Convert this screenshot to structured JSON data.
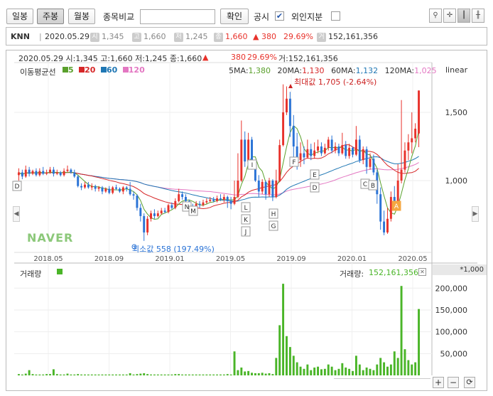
{
  "toolbar": {
    "daily": "일봉",
    "weekly": "주봉",
    "monthly": "월봉",
    "compare_label": "종목비교",
    "compare_placeholder": "",
    "confirm": "확인",
    "disclosure": "공시",
    "disclosure_checked": "✔",
    "foreign": "외인지분",
    "icons": [
      "pin-icon",
      "crosshair-icon",
      "candle-toggle-icon",
      "bar-settings-icon"
    ]
  },
  "ticker": {
    "name": "KNN",
    "date": "2020.05.29",
    "open_badge": "시",
    "open": "1,345",
    "high_badge": "고",
    "high": "1,660",
    "low_badge": "저",
    "low": "1,245",
    "close_badge": "종",
    "close": "1,660",
    "change": "▲ 380",
    "change_pct": "29.69%",
    "volume_badge": "거",
    "volume": "152,161,356"
  },
  "chart_header": {
    "line": "2020.05.29 시:1,345 고:1,660 저:1,245 종:1,660",
    "arrow": "▲",
    "change": "380",
    "pct": "29.69%",
    "vol": "거:152,161,356"
  },
  "ma_legend": {
    "label": "이동평균선",
    "items": [
      {
        "text": "5",
        "color": "#5aa02c"
      },
      {
        "text": "20",
        "color": "#d62728"
      },
      {
        "text": "60",
        "color": "#1f77b4"
      },
      {
        "text": "120",
        "color": "#e377c2"
      }
    ],
    "values": [
      {
        "label": "5MA:",
        "value": "1,380",
        "color": "#5aa02c"
      },
      {
        "label": "20MA:",
        "value": "1,130",
        "color": "#d62728"
      },
      {
        "label": "60MA:",
        "value": "1,132",
        "color": "#1f77b4"
      },
      {
        "label": "120MA:",
        "value": "1,025",
        "color": "#e377c2"
      }
    ],
    "scale": "linear"
  },
  "annotations": {
    "max": "최대값 1,705 (-2.64%)",
    "min": "최소값 558 (197.49%)",
    "watermark": "NAVER",
    "event_labels": [
      "D",
      "I",
      "F",
      "E",
      "D",
      "C",
      "B",
      "A",
      "N",
      "M",
      "L",
      "K",
      "J",
      "H",
      "G"
    ]
  },
  "volume_panel": {
    "label": "거래량",
    "value_label": "거래량:",
    "value": "152,161,356",
    "unit": "*1,000",
    "ticks": [
      "200,000",
      "150,000",
      "100,000",
      "50,000"
    ]
  },
  "colors": {
    "up": "#e8322b",
    "down": "#2a73d6",
    "vol": "#4ab528",
    "ma5": "#5aa02c",
    "ma20": "#d62728",
    "ma60": "#1f77b4",
    "ma120": "#e377c2"
  },
  "chart_data": {
    "type": "candlestick",
    "x_ticks": [
      "2018.05",
      "2018.09",
      "2019.01",
      "2019.05",
      "2019.09",
      "2020.01",
      "2020.05"
    ],
    "y_ticks": [
      "1,500",
      "1,000"
    ],
    "ylim": [
      500,
      1750
    ],
    "volume_ticks": [
      200000,
      150000,
      100000,
      50000
    ],
    "weeks": [
      {
        "o": 1040,
        "c": 1060,
        "h": 1090,
        "l": 1000,
        "v": 3000
      },
      {
        "o": 1060,
        "c": 1030,
        "h": 1080,
        "l": 1010,
        "v": 2000
      },
      {
        "o": 1030,
        "c": 1080,
        "h": 1110,
        "l": 1020,
        "v": 4000
      },
      {
        "o": 1080,
        "c": 1050,
        "h": 1100,
        "l": 1030,
        "v": 12000
      },
      {
        "o": 1050,
        "c": 1070,
        "h": 1080,
        "l": 1040,
        "v": 3000
      },
      {
        "o": 1070,
        "c": 1040,
        "h": 1090,
        "l": 1030,
        "v": 2000
      },
      {
        "o": 1040,
        "c": 1070,
        "h": 1090,
        "l": 1030,
        "v": 2000
      },
      {
        "o": 1070,
        "c": 1050,
        "h": 1100,
        "l": 1040,
        "v": 2000
      },
      {
        "o": 1050,
        "c": 1060,
        "h": 1080,
        "l": 1040,
        "v": 3000
      },
      {
        "o": 1060,
        "c": 1080,
        "h": 1100,
        "l": 1050,
        "v": 3000
      },
      {
        "o": 1080,
        "c": 1050,
        "h": 1100,
        "l": 1030,
        "v": 14000
      },
      {
        "o": 1050,
        "c": 1060,
        "h": 1080,
        "l": 1040,
        "v": 3000
      },
      {
        "o": 1060,
        "c": 1040,
        "h": 1070,
        "l": 1030,
        "v": 2000
      },
      {
        "o": 1040,
        "c": 1070,
        "h": 1090,
        "l": 1030,
        "v": 2000
      },
      {
        "o": 1070,
        "c": 1080,
        "h": 1110,
        "l": 1060,
        "v": 4000
      },
      {
        "o": 1080,
        "c": 1060,
        "h": 1090,
        "l": 1050,
        "v": 2000
      },
      {
        "o": 1060,
        "c": 1030,
        "h": 1080,
        "l": 1020,
        "v": 2000
      },
      {
        "o": 1030,
        "c": 960,
        "h": 1040,
        "l": 950,
        "v": 3000
      },
      {
        "o": 960,
        "c": 950,
        "h": 980,
        "l": 930,
        "v": 2000
      },
      {
        "o": 950,
        "c": 970,
        "h": 990,
        "l": 940,
        "v": 2000
      },
      {
        "o": 970,
        "c": 950,
        "h": 990,
        "l": 940,
        "v": 2000
      },
      {
        "o": 950,
        "c": 960,
        "h": 980,
        "l": 930,
        "v": 2000
      },
      {
        "o": 960,
        "c": 940,
        "h": 970,
        "l": 920,
        "v": 2000
      },
      {
        "o": 940,
        "c": 950,
        "h": 960,
        "l": 920,
        "v": 2000
      },
      {
        "o": 950,
        "c": 920,
        "h": 960,
        "l": 900,
        "v": 2000
      },
      {
        "o": 920,
        "c": 940,
        "h": 950,
        "l": 910,
        "v": 2000
      },
      {
        "o": 940,
        "c": 910,
        "h": 960,
        "l": 900,
        "v": 2000
      },
      {
        "o": 910,
        "c": 950,
        "h": 960,
        "l": 900,
        "v": 2000
      },
      {
        "o": 950,
        "c": 940,
        "h": 970,
        "l": 930,
        "v": 2000
      },
      {
        "o": 940,
        "c": 920,
        "h": 950,
        "l": 910,
        "v": 2000
      },
      {
        "o": 920,
        "c": 950,
        "h": 960,
        "l": 900,
        "v": 2000
      },
      {
        "o": 950,
        "c": 940,
        "h": 960,
        "l": 920,
        "v": 2000
      },
      {
        "o": 940,
        "c": 900,
        "h": 990,
        "l": 890,
        "v": 5000
      },
      {
        "o": 900,
        "c": 890,
        "h": 920,
        "l": 860,
        "v": 2000
      },
      {
        "o": 890,
        "c": 800,
        "h": 900,
        "l": 780,
        "v": 3000
      },
      {
        "o": 800,
        "c": 740,
        "h": 830,
        "l": 700,
        "v": 4000
      },
      {
        "o": 740,
        "c": 620,
        "h": 760,
        "l": 558,
        "v": 5000
      },
      {
        "o": 620,
        "c": 720,
        "h": 740,
        "l": 600,
        "v": 3000
      },
      {
        "o": 720,
        "c": 760,
        "h": 780,
        "l": 700,
        "v": 2000
      },
      {
        "o": 760,
        "c": 740,
        "h": 790,
        "l": 720,
        "v": 2000
      },
      {
        "o": 740,
        "c": 760,
        "h": 780,
        "l": 730,
        "v": 2000
      },
      {
        "o": 760,
        "c": 780,
        "h": 800,
        "l": 750,
        "v": 2000
      },
      {
        "o": 780,
        "c": 770,
        "h": 800,
        "l": 760,
        "v": 2000
      },
      {
        "o": 770,
        "c": 820,
        "h": 830,
        "l": 760,
        "v": 2000
      },
      {
        "o": 820,
        "c": 800,
        "h": 840,
        "l": 790,
        "v": 2000
      },
      {
        "o": 800,
        "c": 850,
        "h": 870,
        "l": 790,
        "v": 3000
      },
      {
        "o": 850,
        "c": 900,
        "h": 940,
        "l": 840,
        "v": 3000
      },
      {
        "o": 900,
        "c": 880,
        "h": 920,
        "l": 860,
        "v": 2000
      },
      {
        "o": 880,
        "c": 850,
        "h": 900,
        "l": 830,
        "v": 2000
      },
      {
        "o": 850,
        "c": 810,
        "h": 860,
        "l": 800,
        "v": 2000
      },
      {
        "o": 810,
        "c": 800,
        "h": 830,
        "l": 780,
        "v": 2000
      },
      {
        "o": 800,
        "c": 830,
        "h": 850,
        "l": 790,
        "v": 2000
      },
      {
        "o": 830,
        "c": 820,
        "h": 850,
        "l": 800,
        "v": 2000
      },
      {
        "o": 820,
        "c": 840,
        "h": 860,
        "l": 810,
        "v": 2000
      },
      {
        "o": 840,
        "c": 850,
        "h": 870,
        "l": 830,
        "v": 2000
      },
      {
        "o": 850,
        "c": 860,
        "h": 880,
        "l": 840,
        "v": 2000
      },
      {
        "o": 860,
        "c": 850,
        "h": 880,
        "l": 840,
        "v": 2000
      },
      {
        "o": 850,
        "c": 870,
        "h": 890,
        "l": 840,
        "v": 2000
      },
      {
        "o": 870,
        "c": 860,
        "h": 900,
        "l": 850,
        "v": 2000
      },
      {
        "o": 860,
        "c": 880,
        "h": 900,
        "l": 840,
        "v": 2000
      },
      {
        "o": 880,
        "c": 850,
        "h": 890,
        "l": 800,
        "v": 3000
      },
      {
        "o": 850,
        "c": 830,
        "h": 880,
        "l": 790,
        "v": 2000
      },
      {
        "o": 830,
        "c": 880,
        "h": 1000,
        "l": 820,
        "v": 55000
      },
      {
        "o": 880,
        "c": 1000,
        "h": 1200,
        "l": 870,
        "v": 12000
      },
      {
        "o": 1000,
        "c": 1300,
        "h": 1440,
        "l": 990,
        "v": 18000
      },
      {
        "o": 1300,
        "c": 1140,
        "h": 1360,
        "l": 1100,
        "v": 9000
      },
      {
        "o": 1140,
        "c": 1300,
        "h": 1350,
        "l": 1120,
        "v": 10000
      },
      {
        "o": 1300,
        "c": 1130,
        "h": 1320,
        "l": 1080,
        "v": 6000
      },
      {
        "o": 1130,
        "c": 1000,
        "h": 1150,
        "l": 990,
        "v": 5000
      },
      {
        "o": 1000,
        "c": 920,
        "h": 1040,
        "l": 880,
        "v": 5000
      },
      {
        "o": 920,
        "c": 990,
        "h": 1010,
        "l": 900,
        "v": 6000
      },
      {
        "o": 990,
        "c": 900,
        "h": 1000,
        "l": 860,
        "v": 4000
      },
      {
        "o": 900,
        "c": 1000,
        "h": 1020,
        "l": 880,
        "v": 5000
      },
      {
        "o": 1000,
        "c": 880,
        "h": 1010,
        "l": 850,
        "v": 3000
      },
      {
        "o": 880,
        "c": 1000,
        "h": 1080,
        "l": 870,
        "v": 40000
      },
      {
        "o": 1000,
        "c": 1260,
        "h": 1300,
        "l": 990,
        "v": 115000
      },
      {
        "o": 1260,
        "c": 1500,
        "h": 1705,
        "l": 1250,
        "v": 210000
      },
      {
        "o": 1500,
        "c": 1600,
        "h": 1690,
        "l": 1480,
        "v": 90000
      },
      {
        "o": 1600,
        "c": 1400,
        "h": 1650,
        "l": 1320,
        "v": 65000
      },
      {
        "o": 1400,
        "c": 1250,
        "h": 1480,
        "l": 1150,
        "v": 45000
      },
      {
        "o": 1250,
        "c": 1150,
        "h": 1350,
        "l": 1080,
        "v": 30000
      },
      {
        "o": 1150,
        "c": 1200,
        "h": 1280,
        "l": 1100,
        "v": 20000
      },
      {
        "o": 1200,
        "c": 1170,
        "h": 1250,
        "l": 1120,
        "v": 15000
      },
      {
        "o": 1170,
        "c": 1230,
        "h": 1300,
        "l": 1160,
        "v": 25000
      },
      {
        "o": 1230,
        "c": 1180,
        "h": 1270,
        "l": 1150,
        "v": 12000
      },
      {
        "o": 1180,
        "c": 1220,
        "h": 1280,
        "l": 1160,
        "v": 18000
      },
      {
        "o": 1220,
        "c": 1250,
        "h": 1300,
        "l": 1200,
        "v": 20000
      },
      {
        "o": 1250,
        "c": 1200,
        "h": 1280,
        "l": 1180,
        "v": 14000
      },
      {
        "o": 1200,
        "c": 1240,
        "h": 1270,
        "l": 1190,
        "v": 15000
      },
      {
        "o": 1240,
        "c": 1300,
        "h": 1320,
        "l": 1220,
        "v": 25000
      },
      {
        "o": 1300,
        "c": 1220,
        "h": 1330,
        "l": 1200,
        "v": 20000
      },
      {
        "o": 1220,
        "c": 1250,
        "h": 1280,
        "l": 1200,
        "v": 12000
      },
      {
        "o": 1250,
        "c": 1200,
        "h": 1270,
        "l": 1180,
        "v": 15000
      },
      {
        "o": 1200,
        "c": 1260,
        "h": 1350,
        "l": 1190,
        "v": 28000
      },
      {
        "o": 1260,
        "c": 1180,
        "h": 1290,
        "l": 1160,
        "v": 18000
      },
      {
        "o": 1180,
        "c": 1240,
        "h": 1270,
        "l": 1160,
        "v": 15000
      },
      {
        "o": 1240,
        "c": 1190,
        "h": 1250,
        "l": 1170,
        "v": 10000
      },
      {
        "o": 1190,
        "c": 1300,
        "h": 1400,
        "l": 1180,
        "v": 45000
      },
      {
        "o": 1300,
        "c": 1150,
        "h": 1330,
        "l": 1130,
        "v": 25000
      },
      {
        "o": 1150,
        "c": 1230,
        "h": 1250,
        "l": 1120,
        "v": 12000
      },
      {
        "o": 1230,
        "c": 1100,
        "h": 1250,
        "l": 1050,
        "v": 18000
      },
      {
        "o": 1100,
        "c": 1160,
        "h": 1200,
        "l": 1080,
        "v": 15000
      },
      {
        "o": 1160,
        "c": 1060,
        "h": 1190,
        "l": 1040,
        "v": 12000
      },
      {
        "o": 1060,
        "c": 900,
        "h": 1080,
        "l": 830,
        "v": 25000
      },
      {
        "o": 900,
        "c": 700,
        "h": 950,
        "l": 640,
        "v": 40000
      },
      {
        "o": 700,
        "c": 620,
        "h": 780,
        "l": 600,
        "v": 30000
      },
      {
        "o": 620,
        "c": 720,
        "h": 800,
        "l": 610,
        "v": 20000
      },
      {
        "o": 720,
        "c": 880,
        "h": 920,
        "l": 700,
        "v": 25000
      },
      {
        "o": 880,
        "c": 850,
        "h": 960,
        "l": 820,
        "v": 55000
      },
      {
        "o": 850,
        "c": 1000,
        "h": 1120,
        "l": 840,
        "v": 40000
      },
      {
        "o": 1000,
        "c": 1080,
        "h": 1590,
        "l": 980,
        "v": 205000
      },
      {
        "o": 1080,
        "c": 1220,
        "h": 1280,
        "l": 1060,
        "v": 60000
      },
      {
        "o": 1220,
        "c": 1280,
        "h": 1340,
        "l": 1150,
        "v": 35000
      },
      {
        "o": 1280,
        "c": 1310,
        "h": 1500,
        "l": 1200,
        "v": 25000
      },
      {
        "o": 1310,
        "c": 1380,
        "h": 1420,
        "l": 1280,
        "v": 30000
      },
      {
        "o": 1345,
        "c": 1660,
        "h": 1660,
        "l": 1245,
        "v": 152161
      }
    ]
  }
}
